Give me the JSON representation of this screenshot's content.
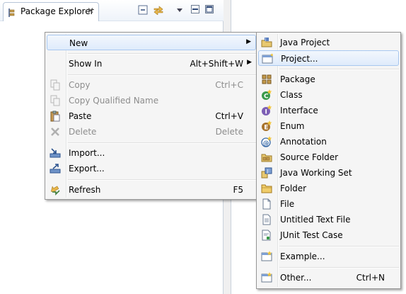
{
  "view": {
    "tab_title": "Package Explorer",
    "tab_close": "✕"
  },
  "context_menu": {
    "items": [
      {
        "label": "New",
        "accel": ""
      },
      {
        "label": "Show In",
        "accel": "Alt+Shift+W"
      },
      {
        "label": "Copy",
        "accel": "Ctrl+C"
      },
      {
        "label": "Copy Qualified Name",
        "accel": ""
      },
      {
        "label": "Paste",
        "accel": "Ctrl+V"
      },
      {
        "label": "Delete",
        "accel": "Delete"
      },
      {
        "label": "Import...",
        "accel": ""
      },
      {
        "label": "Export...",
        "accel": ""
      },
      {
        "label": "Refresh",
        "accel": "F5"
      }
    ]
  },
  "submenu_new": {
    "items": [
      {
        "label": "Java Project",
        "accel": ""
      },
      {
        "label": "Project...",
        "accel": ""
      },
      {
        "label": "Package",
        "accel": ""
      },
      {
        "label": "Class",
        "accel": ""
      },
      {
        "label": "Interface",
        "accel": ""
      },
      {
        "label": "Enum",
        "accel": ""
      },
      {
        "label": "Annotation",
        "accel": ""
      },
      {
        "label": "Source Folder",
        "accel": ""
      },
      {
        "label": "Java Working Set",
        "accel": ""
      },
      {
        "label": "Folder",
        "accel": ""
      },
      {
        "label": "File",
        "accel": ""
      },
      {
        "label": "Untitled Text File",
        "accel": ""
      },
      {
        "label": "JUnit Test Case",
        "accel": ""
      },
      {
        "label": "Example...",
        "accel": ""
      },
      {
        "label": "Other...",
        "accel": "Ctrl+N"
      }
    ]
  },
  "colors": {
    "highlight": "#dfebfb",
    "disabled_text": "#8d8d8d",
    "class_green": "#3a9a4a",
    "interface_purple": "#7d5fb5",
    "enum_brown": "#a8742e"
  }
}
